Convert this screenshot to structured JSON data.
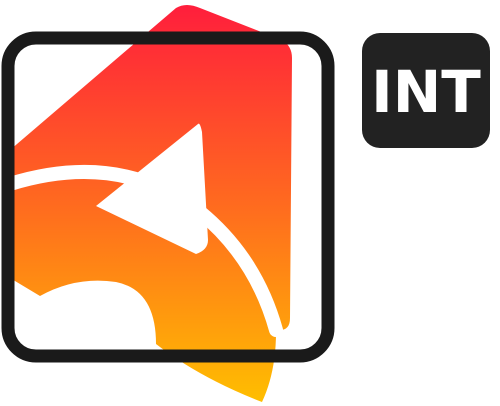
{
  "logo": {
    "badge_text": "INT",
    "colors": {
      "frame": "#1a1a1a",
      "badge_background": "#222222",
      "badge_text": "#ffffff",
      "gradient_top": "#ff1e3c",
      "gradient_mid": "#ff6a1f",
      "gradient_bottom": "#ffbe00",
      "arrow": "#ffffff",
      "background": "#ffffff"
    }
  }
}
